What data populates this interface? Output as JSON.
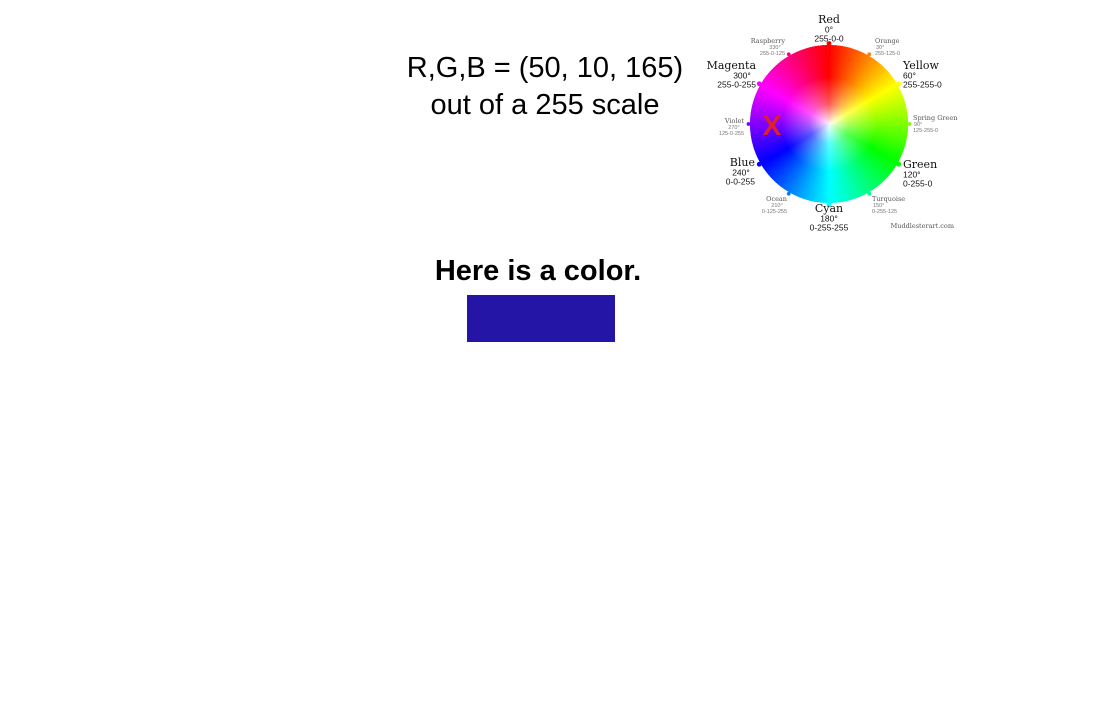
{
  "rgb_caption": {
    "line1": "R,G,B = (50, 10, 165)",
    "line2": "out of a 255 scale"
  },
  "heading": "Here is a color.",
  "swatch": {
    "color": "#2415a6"
  },
  "marker": {
    "label": "X",
    "color": "#e0202a"
  },
  "wheel": {
    "credit": "Muddlesterart.com",
    "colors": [
      {
        "name": "Red",
        "deg": "0°",
        "rgb": "255-0-0",
        "hex": "#ff0000",
        "major": true
      },
      {
        "name": "Orange",
        "deg": "30°",
        "rgb": "255-125-0",
        "hex": "#ff7d00",
        "major": false
      },
      {
        "name": "Yellow",
        "deg": "60°",
        "rgb": "255-255-0",
        "hex": "#ffff00",
        "major": true
      },
      {
        "name": "Spring Green",
        "deg": "90°",
        "rgb": "125-255-0",
        "hex": "#7dff00",
        "major": false
      },
      {
        "name": "Green",
        "deg": "120°",
        "rgb": "0-255-0",
        "hex": "#00ff00",
        "major": true
      },
      {
        "name": "Turquoise",
        "deg": "150°",
        "rgb": "0-255-125",
        "hex": "#00ff7d",
        "major": false
      },
      {
        "name": "Cyan",
        "deg": "180°",
        "rgb": "0-255-255",
        "hex": "#00ffff",
        "major": true
      },
      {
        "name": "Ocean",
        "deg": "210°",
        "rgb": "0-125-255",
        "hex": "#007dff",
        "major": false
      },
      {
        "name": "Blue",
        "deg": "240°",
        "rgb": "0-0-255",
        "hex": "#0000ff",
        "major": true
      },
      {
        "name": "Violet",
        "deg": "270°",
        "rgb": "125-0-255",
        "hex": "#7d00ff",
        "major": false
      },
      {
        "name": "Magenta",
        "deg": "300°",
        "rgb": "255-0-255",
        "hex": "#ff00ff",
        "major": true
      },
      {
        "name": "Raspberry",
        "deg": "330°",
        "rgb": "255-0-125",
        "hex": "#ff007d",
        "major": false
      }
    ]
  }
}
